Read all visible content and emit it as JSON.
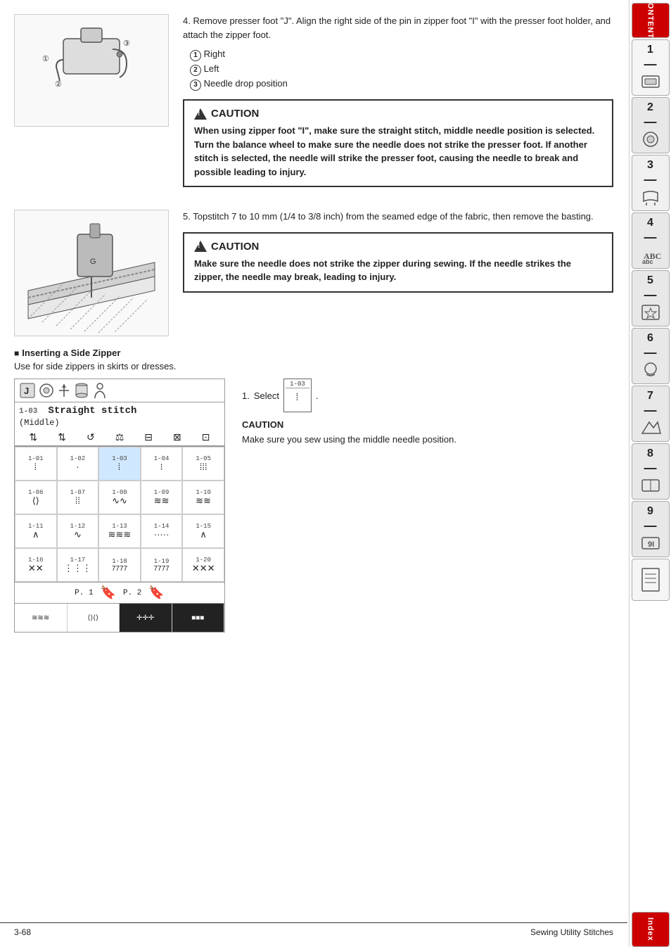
{
  "page": {
    "footer_left": "3-68",
    "footer_right": "Sewing Utility Stitches"
  },
  "sidebar": {
    "contents_label": "CONTENTS",
    "index_label": "Index",
    "tabs": [
      {
        "number": "1",
        "icon": "🧵"
      },
      {
        "number": "2",
        "icon": "🪡"
      },
      {
        "number": "3",
        "icon": "👕"
      },
      {
        "number": "4",
        "icon": "✂️"
      },
      {
        "number": "5",
        "icon": "⭐"
      },
      {
        "number": "6",
        "icon": "🪡"
      },
      {
        "number": "7",
        "icon": "📐"
      },
      {
        "number": "8",
        "icon": "🧵"
      },
      {
        "number": "9",
        "icon": "🔧"
      },
      {
        "number": "notes",
        "icon": "📋"
      }
    ]
  },
  "step4": {
    "number": "4.",
    "text": "Remove presser foot \"J\". Align the right side of the pin in zipper foot \"I\" with the presser foot holder, and attach the zipper foot.",
    "items": [
      {
        "num": "①",
        "label": "Right"
      },
      {
        "num": "②",
        "label": "Left"
      },
      {
        "num": "③",
        "label": "Needle drop position"
      }
    ]
  },
  "caution1": {
    "title": "CAUTION",
    "text": "When using zipper foot \"I\", make sure the straight stitch, middle needle position is selected. Turn the balance wheel to make sure the needle does not strike the presser foot. If another stitch is selected, the needle will strike the presser foot, causing the needle to break and possible leading to injury."
  },
  "step5": {
    "number": "5.",
    "text": "Topstitch 7 to 10 mm (1/4 to 3/8 inch) from the seamed edge of the fabric, then remove the basting."
  },
  "caution2": {
    "title": "CAUTION",
    "text": "Make sure the needle does not strike the zipper during sewing. If the needle strikes the zipper, the needle may break, leading to injury."
  },
  "side_zipper": {
    "header": "Inserting a Side Zipper",
    "sub": "Use for side zippers in skirts or dresses."
  },
  "stitch_panel": {
    "title": "Straight stitch",
    "subtitle": "(Middle)",
    "stitch_code": "1-03",
    "rows_header": [
      "⟷",
      "⟷",
      "🔄",
      "⚖",
      "⊟",
      "⊠",
      "⊡"
    ],
    "grid": [
      {
        "id": "1-01",
        "symbol": "||"
      },
      {
        "id": "1-02",
        "symbol": "·"
      },
      {
        "id": "1-03",
        "symbol": "||"
      },
      {
        "id": "1-04",
        "symbol": "| |"
      },
      {
        "id": "1-05",
        "symbol": "|||"
      },
      {
        "id": "1-06",
        "symbol": "Z"
      },
      {
        "id": "1-07",
        "symbol": "||"
      },
      {
        "id": "1-08",
        "symbol": "~~"
      },
      {
        "id": "1-09",
        "symbol": "WWW"
      },
      {
        "id": "1-10",
        "symbol": "WWW"
      },
      {
        "id": "1-11",
        "symbol": "^"
      },
      {
        "id": "1-12",
        "symbol": "W"
      },
      {
        "id": "1-13",
        "symbol": "WWW"
      },
      {
        "id": "1-14",
        "symbol": "..."
      },
      {
        "id": "1-15",
        "symbol": "^"
      },
      {
        "id": "1-16",
        "symbol": "XXX"
      },
      {
        "id": "1-17",
        "symbol": "|||"
      },
      {
        "id": "1-18",
        "symbol": "7777"
      },
      {
        "id": "1-19",
        "symbol": "7777"
      },
      {
        "id": "1-20",
        "symbol": "XXX"
      }
    ],
    "pages": [
      "P. 1",
      "P. 2"
    ]
  },
  "step1_side": {
    "number": "1.",
    "text": "Select",
    "stitch_ref": "1-03",
    "period": "."
  },
  "caution3": {
    "title": "CAUTION",
    "text": "Make sure you sew using the middle needle position."
  }
}
